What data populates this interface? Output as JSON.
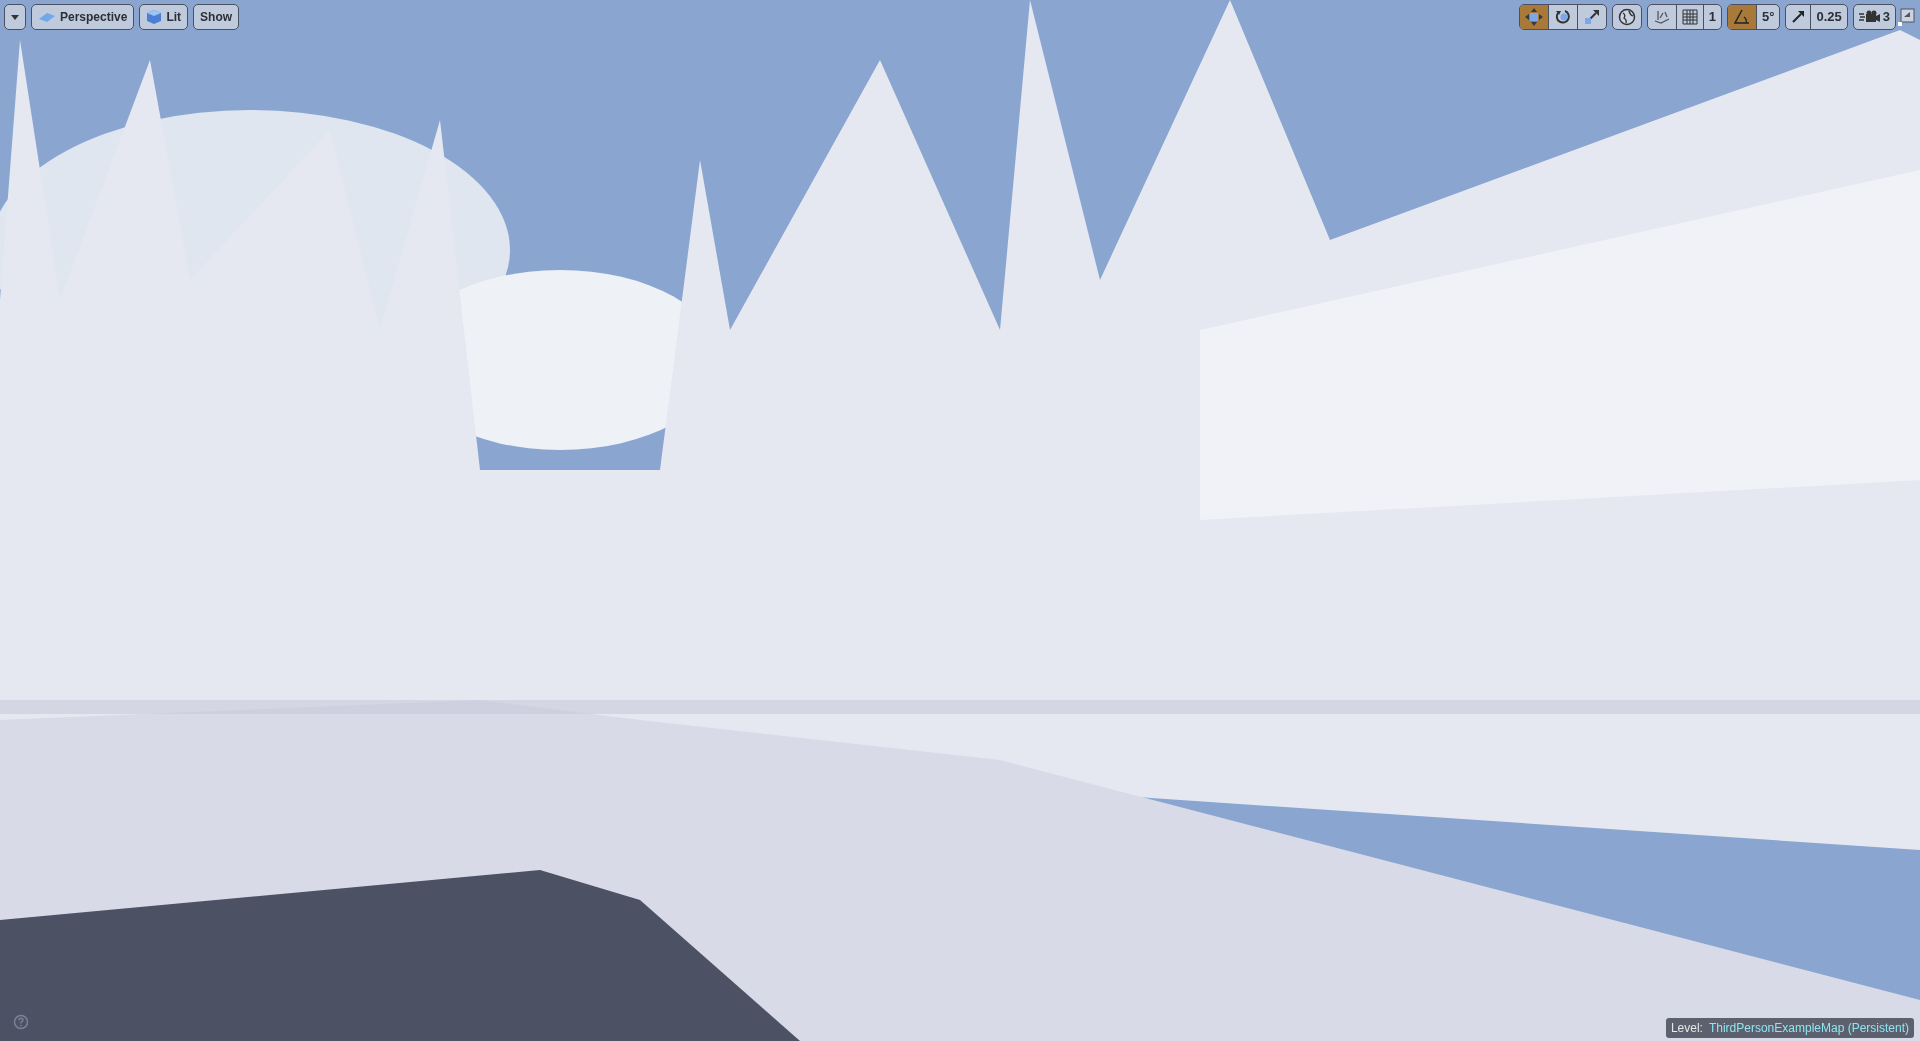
{
  "left_toolbar": [
    {
      "kind": "menu"
    },
    {
      "kind": "view",
      "label": "Perspective"
    },
    {
      "kind": "lit",
      "label": "Lit"
    },
    {
      "kind": "plain",
      "label": "Show"
    }
  ],
  "transform_tools": [
    {
      "kind": "translate",
      "selected": true
    },
    {
      "kind": "rotate",
      "selected": false
    },
    {
      "kind": "scale",
      "selected": false
    }
  ],
  "snap": {
    "grid_on": false,
    "grid_value": "1",
    "rotation_on": true,
    "rotation_value": "5°",
    "scale_on": false,
    "scale_value": "0.25"
  },
  "camera_speed": "3",
  "status": {
    "label": "Level:",
    "value": "ThirdPersonExampleMap (Persistent)"
  }
}
